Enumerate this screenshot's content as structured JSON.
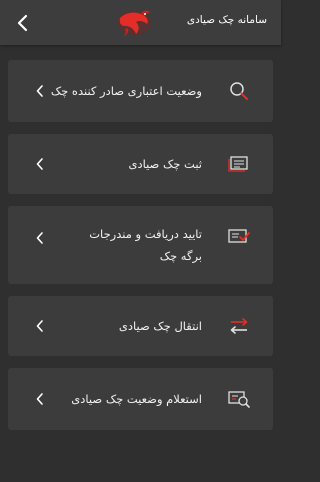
{
  "header": {
    "title": "سامانه چک صیادی",
    "back_icon": "chevron-left-icon",
    "logo_icon": "red-bird-logo"
  },
  "menu": {
    "items": [
      {
        "label": "وضعیت اعتباری صادر کننده چک",
        "icon": "magnifier-icon"
      },
      {
        "label": "ثبت چک صیادی",
        "icon": "cheque-register-icon"
      },
      {
        "label": "تایید دریافت و مندرجات برگه چک",
        "icon": "cheque-confirm-icon"
      },
      {
        "label": "انتقال چک صیادی",
        "icon": "transfer-arrows-icon"
      },
      {
        "label": "استعلام وضعیت چک صیادی",
        "icon": "cheque-inquiry-icon"
      }
    ]
  },
  "colors": {
    "background": "#2f2f30",
    "header": "#3d3d3e",
    "card": "#3c3c3d",
    "accent": "#e52d27",
    "text": "#f2f2f2"
  }
}
